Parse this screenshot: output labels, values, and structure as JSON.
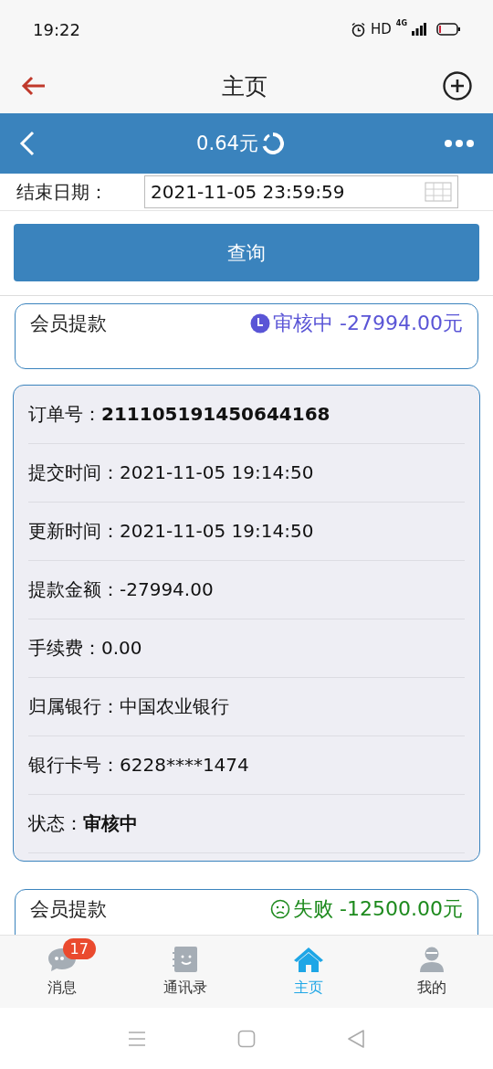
{
  "status_bar": {
    "time": "19:22",
    "network": "HD",
    "network_type": "4G"
  },
  "app_header": {
    "title": "主页"
  },
  "wallet_bar": {
    "balance": "0.64元"
  },
  "filter": {
    "label": "结束日期：",
    "value": "2021-11-05 23:59:59"
  },
  "query_button": "查询",
  "records": [
    {
      "title": "会员提款",
      "kind": "pending",
      "status": "审核中 -27994.00元",
      "details": [
        {
          "label": "订单号：",
          "value": "211105191450644168",
          "emphasis": true
        },
        {
          "label": "提交时间：",
          "value": "2021-11-05 19:14:50",
          "emphasis": false
        },
        {
          "label": "更新时间：",
          "value": "2021-11-05 19:14:50",
          "emphasis": false
        },
        {
          "label": "提款金额：",
          "value": "-27994.00",
          "emphasis": false
        },
        {
          "label": "手续费：",
          "value": "0.00",
          "emphasis": false
        },
        {
          "label": "归属银行：",
          "value": "中国农业银行",
          "emphasis": false
        },
        {
          "label": "银行卡号：",
          "value": "6228****1474",
          "emphasis": false
        },
        {
          "label": "状态：",
          "value": "审核中",
          "emphasis": true
        }
      ]
    },
    {
      "title": "会员提款",
      "kind": "failed",
      "status": "失败 -12500.00元"
    }
  ],
  "tabs": [
    {
      "label": "消息",
      "kind": "chat",
      "selected": false,
      "badge": "17"
    },
    {
      "label": "通讯录",
      "kind": "contacts",
      "selected": false
    },
    {
      "label": "主页",
      "kind": "home",
      "selected": true
    },
    {
      "label": "我的",
      "kind": "profile",
      "selected": false
    }
  ]
}
